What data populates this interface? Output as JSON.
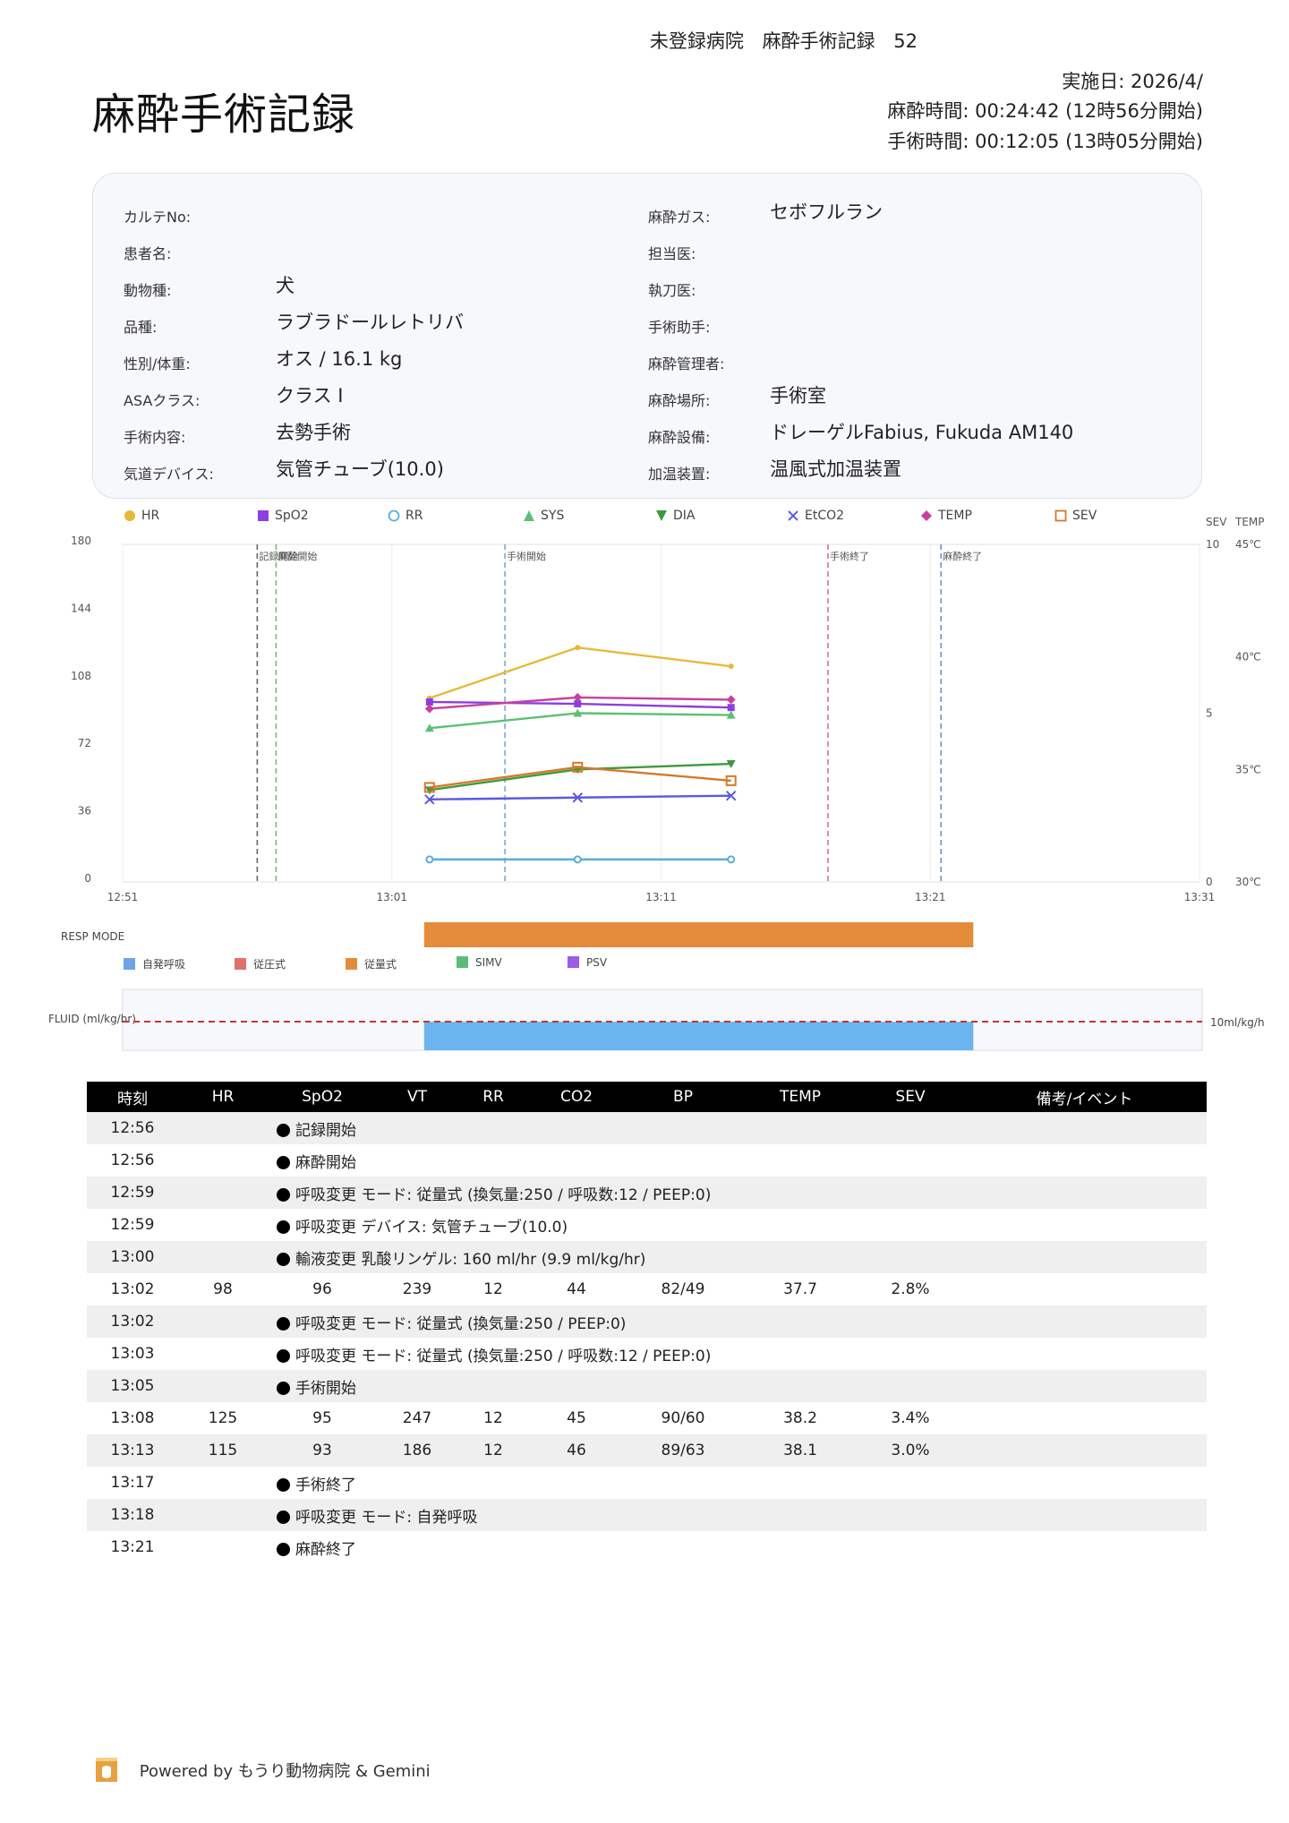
{
  "header": {
    "hospital_line": "未登録病院",
    "record_title_small": "麻酔手術記録",
    "record_id_partial": "52",
    "date": "実施日: 2026/4/",
    "anesthesia_time": "麻酔時間: 00:24:42 (12時56分開始)",
    "surgery_time": "手術時間: 00:12:05 (13時05分開始)"
  },
  "title": "麻酔手術記録",
  "patient_info": {
    "left": [
      {
        "label": "カルテNo:",
        "value": ""
      },
      {
        "label": "患者名:",
        "value": ""
      },
      {
        "label": "動物種:",
        "value": "犬"
      },
      {
        "label": "品種:",
        "value": "ラブラドールレトリバ"
      },
      {
        "label": "性別/体重:",
        "value": "オス / 16.1 kg"
      },
      {
        "label": "ASAクラス:",
        "value": "クラス Ⅰ"
      },
      {
        "label": "手術内容:",
        "value": "去勢手術"
      },
      {
        "label": "気道デバイス:",
        "value": "気管チューブ(10.0)"
      }
    ],
    "right": [
      {
        "label": "麻酔ガス:",
        "value": "セボフルラン"
      },
      {
        "label": "担当医:",
        "value": ""
      },
      {
        "label": "執刀医:",
        "value": ""
      },
      {
        "label": "手術助手:",
        "value": ""
      },
      {
        "label": "麻酔管理者:",
        "value": ""
      },
      {
        "label": "麻酔場所:",
        "value": "手術室"
      },
      {
        "label": "麻酔設備:",
        "value": "ドレーゲルFabius, Fukuda AM140"
      },
      {
        "label": "加温装置:",
        "value": "温風式加温装置"
      }
    ]
  },
  "legend": [
    {
      "name": "HR",
      "color": "#e8b83a",
      "icon": "circle-filled"
    },
    {
      "name": "SpO2",
      "color": "#8b3fe0",
      "icon": "square-filled"
    },
    {
      "name": "RR",
      "color": "#5aaed6",
      "icon": "circle-open"
    },
    {
      "name": "SYS",
      "color": "#5cc072",
      "icon": "triangle-up"
    },
    {
      "name": "DIA",
      "color": "#3e9a3e",
      "icon": "triangle-down"
    },
    {
      "name": "EtCO2",
      "color": "#5a5ae0",
      "icon": "x-mark"
    },
    {
      "name": "TEMP",
      "color": "#c640a0",
      "icon": "diamond"
    },
    {
      "name": "SEV",
      "color": "#d6782a",
      "icon": "square-open"
    }
  ],
  "chart_data": {
    "type": "line",
    "x_ticks": [
      "12:51",
      "13:01",
      "13:11",
      "13:21",
      "13:31"
    ],
    "y_left": {
      "min": 0,
      "max": 180,
      "ticks": [
        0,
        36,
        72,
        108,
        144,
        180
      ]
    },
    "y_sev": {
      "label": "SEV",
      "min": 0,
      "max": 10,
      "ticks": [
        0,
        5,
        10
      ]
    },
    "y_temp": {
      "label": "TEMP",
      "min": 30,
      "max": 45,
      "ticks": [
        "30℃",
        "35℃",
        "40℃",
        "45℃"
      ]
    },
    "x_range_min": [
      0,
      40
    ],
    "events": [
      {
        "time_min": 5,
        "label": "記録開始",
        "color": "#666666"
      },
      {
        "time_min": 5.7,
        "label": "麻酔開始",
        "color": "#6cc06c"
      },
      {
        "time_min": 14.2,
        "label": "手術開始",
        "color": "#7aa6d8"
      },
      {
        "time_min": 26.2,
        "label": "手術終了",
        "color": "#e07080"
      },
      {
        "time_min": 30.4,
        "label": "麻酔終了",
        "color": "#6a8fd0"
      }
    ],
    "series": [
      {
        "name": "HR",
        "axis": "left",
        "color": "#e8b83a",
        "marker": "circle",
        "x_min": [
          11.4,
          16.9,
          22.6
        ],
        "values": [
          98,
          125,
          115
        ]
      },
      {
        "name": "SpO2",
        "axis": "left",
        "color": "#8b3fe0",
        "marker": "square",
        "x_min": [
          11.4,
          16.9,
          22.6
        ],
        "values": [
          96,
          95,
          93
        ]
      },
      {
        "name": "RR",
        "axis": "left",
        "color": "#5aaed6",
        "marker": "circle-open",
        "x_min": [
          11.4,
          16.9,
          22.6
        ],
        "values": [
          12,
          12,
          12
        ]
      },
      {
        "name": "SYS",
        "axis": "left",
        "color": "#5cc072",
        "marker": "triangle-up",
        "x_min": [
          11.4,
          16.9,
          22.6
        ],
        "values": [
          82,
          90,
          89
        ]
      },
      {
        "name": "DIA",
        "axis": "left",
        "color": "#3e9a3e",
        "marker": "triangle-down",
        "x_min": [
          11.4,
          16.9,
          22.6
        ],
        "values": [
          49,
          60,
          63
        ]
      },
      {
        "name": "EtCO2",
        "axis": "left",
        "color": "#5a5ae0",
        "marker": "x",
        "x_min": [
          11.4,
          16.9,
          22.6
        ],
        "values": [
          44,
          45,
          46
        ]
      },
      {
        "name": "TEMP",
        "axis": "temp",
        "color": "#c640a0",
        "marker": "diamond",
        "x_min": [
          11.4,
          16.9,
          22.6
        ],
        "values": [
          37.7,
          38.2,
          38.1
        ]
      },
      {
        "name": "SEV",
        "axis": "sev",
        "color": "#d6782a",
        "marker": "square-open",
        "x_min": [
          11.4,
          16.9,
          22.6
        ],
        "values": [
          2.8,
          3.4,
          3.0
        ]
      }
    ]
  },
  "resp_mode": {
    "label": "RESP MODE",
    "bars": [
      {
        "start_min": 11.0,
        "end_min": 31.0,
        "color": "#e58c3c"
      }
    ],
    "legend": [
      {
        "name": "自発呼吸",
        "color": "#6fa3e8"
      },
      {
        "name": "従圧式",
        "color": "#e07070"
      },
      {
        "name": "従量式",
        "color": "#e58c3c"
      },
      {
        "name": "SIMV",
        "color": "#5dbb7a"
      },
      {
        "name": "PSV",
        "color": "#9b5ce6"
      }
    ]
  },
  "fluid": {
    "label": "FLUID (ml/kg/hr)",
    "ref_label": "10ml/kg/h",
    "bars": [
      {
        "start_min": 11.0,
        "end_min": 31.0,
        "value": 9.9,
        "color": "#6ab4f0"
      }
    ]
  },
  "table": {
    "headers": [
      "時刻",
      "HR",
      "SpO2",
      "VT",
      "RR",
      "CO2",
      "BP",
      "TEMP",
      "SEV",
      "備考/イベント"
    ],
    "rows": [
      {
        "time": "12:56",
        "event": "記録開始"
      },
      {
        "time": "12:56",
        "event": "麻酔開始"
      },
      {
        "time": "12:59",
        "event": "呼吸変更 モード: 従量式 (換気量:250 / 呼吸数:12 / PEEP:0)"
      },
      {
        "time": "12:59",
        "event": "呼吸変更 デバイス: 気管チューブ(10.0)"
      },
      {
        "time": "13:00",
        "event": "輸液変更 乳酸リンゲル: 160 ml/hr (9.9 ml/kg/hr)"
      },
      {
        "time": "13:02",
        "hr": "98",
        "spo2": "96",
        "vt": "239",
        "rr": "12",
        "co2": "44",
        "bp": "82/49",
        "temp": "37.7",
        "sev": "2.8%"
      },
      {
        "time": "13:02",
        "event": "呼吸変更 モード: 従量式 (換気量:250 / PEEP:0)"
      },
      {
        "time": "13:03",
        "event": "呼吸変更 モード: 従量式 (換気量:250 / 呼吸数:12 / PEEP:0)"
      },
      {
        "time": "13:05",
        "event": "手術開始"
      },
      {
        "time": "13:08",
        "hr": "125",
        "spo2": "95",
        "vt": "247",
        "rr": "12",
        "co2": "45",
        "bp": "90/60",
        "temp": "38.2",
        "sev": "3.4%"
      },
      {
        "time": "13:13",
        "hr": "115",
        "spo2": "93",
        "vt": "186",
        "rr": "12",
        "co2": "46",
        "bp": "89/63",
        "temp": "38.1",
        "sev": "3.0%"
      },
      {
        "time": "13:17",
        "event": "手術終了"
      },
      {
        "time": "13:18",
        "event": "呼吸変更 モード: 自発呼吸"
      },
      {
        "time": "13:21",
        "event": "麻酔終了"
      }
    ]
  },
  "footer": {
    "text": "Powered by もうり動物病院 & Gemini"
  }
}
